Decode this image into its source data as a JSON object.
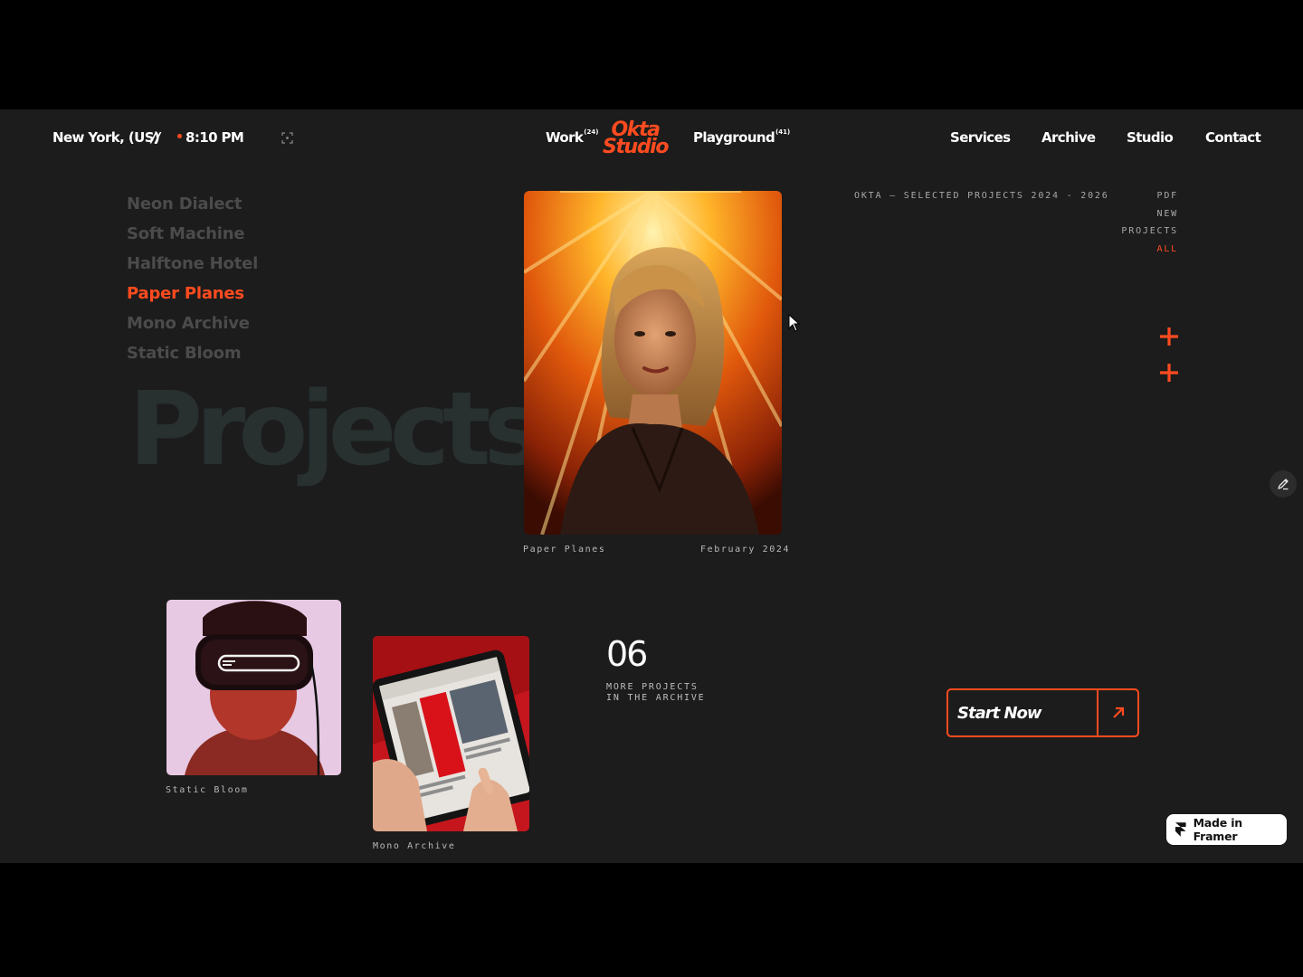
{
  "header": {
    "location": "New York, (US)",
    "separator": "//",
    "time": "8:10 PM",
    "work_label": "Work",
    "work_count": "(24)",
    "logo_line1": "Okta",
    "logo_line2": "Studio",
    "playground_label": "Playground",
    "playground_count": "(41)",
    "nav": [
      "Services",
      "Archive",
      "Studio",
      "Contact"
    ]
  },
  "projects_list": [
    "Neon Dialect",
    "Soft Machine",
    "Halftone Hotel",
    "Paper Planes",
    "Mono Archive",
    "Static Bloom"
  ],
  "active_project": "Paper Planes",
  "big_word": "Projects",
  "hero": {
    "caption_left": "Paper Planes",
    "caption_right": "February 2024"
  },
  "meta": {
    "title": "OKTA — SELECTED PROJECTS 2024 - 2026",
    "filters": [
      "PDF",
      "NEW",
      "PROJECTS",
      "ALL"
    ],
    "active_filter": "ALL"
  },
  "cards": [
    {
      "label": "Static Bloom"
    },
    {
      "label": "Mono Archive"
    }
  ],
  "archive": {
    "count": "06",
    "line1": "MORE PROJECTS",
    "line2": "IN THE ARCHIVE"
  },
  "cta": {
    "label": "Start Now"
  },
  "badge": {
    "label": "Made in Framer"
  },
  "colors": {
    "accent": "#ff4b1f",
    "background": "#1c1c1c",
    "letterbox": "#000000"
  },
  "icons": [
    "expand-icon",
    "plus-icon",
    "pencil-icon",
    "arrow-up-right-icon",
    "framer-logo-icon",
    "cursor-icon"
  ]
}
